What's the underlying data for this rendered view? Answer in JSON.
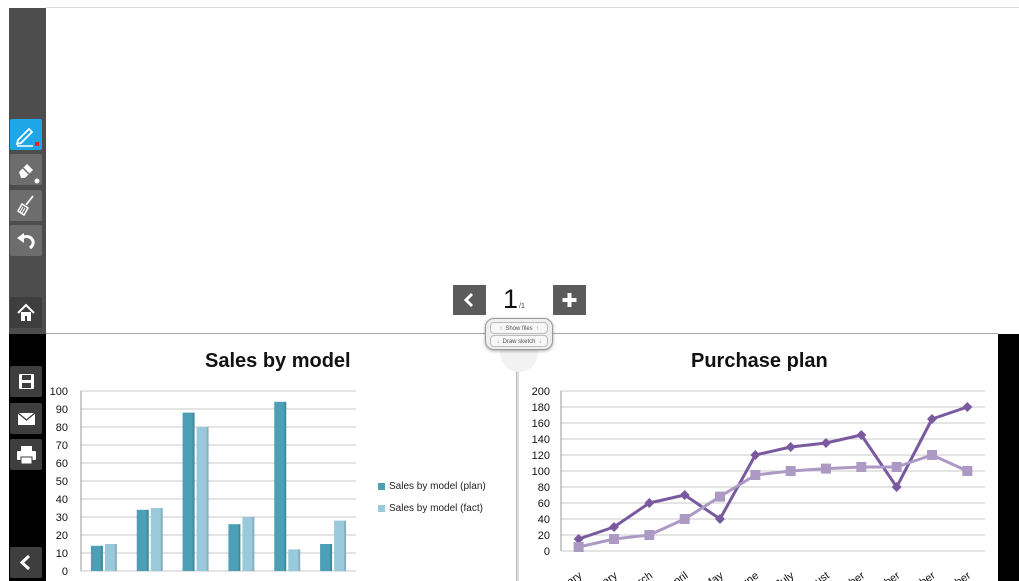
{
  "toolbar": {
    "tools": [
      {
        "name": "pen-tool",
        "icon": "pen-icon",
        "active": true
      },
      {
        "name": "eraser-tool",
        "icon": "eraser-icon",
        "active": false
      },
      {
        "name": "clear-tool",
        "icon": "broom-icon",
        "active": false
      },
      {
        "name": "undo-tool",
        "icon": "undo-icon",
        "active": false
      },
      {
        "name": "home-tool",
        "icon": "home-icon",
        "active": false
      },
      {
        "name": "save-tool",
        "icon": "floppy-disk-icon",
        "active": false
      },
      {
        "name": "email-tool",
        "icon": "envelope-icon",
        "active": false
      },
      {
        "name": "print-tool",
        "icon": "printer-icon",
        "active": false
      },
      {
        "name": "collapse-tool",
        "icon": "chevron-left-icon",
        "active": false
      }
    ],
    "active_color": "#1ea6e6"
  },
  "pager": {
    "current": "1",
    "total": "/1",
    "prev_icon": "chevron-left-icon",
    "add_icon": "plus-icon"
  },
  "handle": {
    "show_files": "Show files",
    "draw_sketch": "Draw sketch",
    "up_arrow": "↑",
    "down_arrow": "↓"
  },
  "chart_data": [
    {
      "type": "bar",
      "title": "Sales by model",
      "categories": [
        "",
        "",
        "",
        "",
        "",
        ""
      ],
      "series": [
        {
          "name": "Sales by model (plan)",
          "values": [
            14,
            34,
            88,
            26,
            94,
            15
          ],
          "color": "#4c9fb4"
        },
        {
          "name": "Sales by model (fact)",
          "values": [
            15,
            35,
            80,
            30,
            12,
            28
          ],
          "color": "#9ac9dc"
        }
      ],
      "ylim": [
        0,
        100
      ],
      "yticks": [
        "0",
        "10",
        "20",
        "30",
        "40",
        "50",
        "60",
        "70",
        "80",
        "90",
        "100"
      ],
      "grid": true,
      "legend_position": "right"
    },
    {
      "type": "line",
      "title": "Purchase plan",
      "categories": [
        "January",
        "February",
        "March",
        "April",
        "May",
        "June",
        "July",
        "August",
        "September",
        "October",
        "November",
        "December"
      ],
      "category_labels_visible": [
        "uary",
        "uary",
        "arch",
        "April",
        "May",
        "June",
        "July",
        "gust",
        "mber",
        "ober",
        "mber",
        "mber"
      ],
      "series": [
        {
          "values": [
            15,
            30,
            60,
            70,
            40,
            120,
            130,
            135,
            145,
            80,
            165,
            180
          ],
          "color": "#7a5a9e",
          "marker": "diamond"
        },
        {
          "values": [
            5,
            15,
            20,
            40,
            68,
            95,
            100,
            103,
            105,
            105,
            120,
            100
          ],
          "color": "#ad9ac4",
          "marker": "square"
        }
      ],
      "ylim": [
        0,
        200
      ],
      "yticks": [
        "0",
        "20",
        "40",
        "60",
        "80",
        "100",
        "120",
        "140",
        "160",
        "180",
        "200"
      ],
      "grid": true,
      "legend_position": "none"
    }
  ]
}
